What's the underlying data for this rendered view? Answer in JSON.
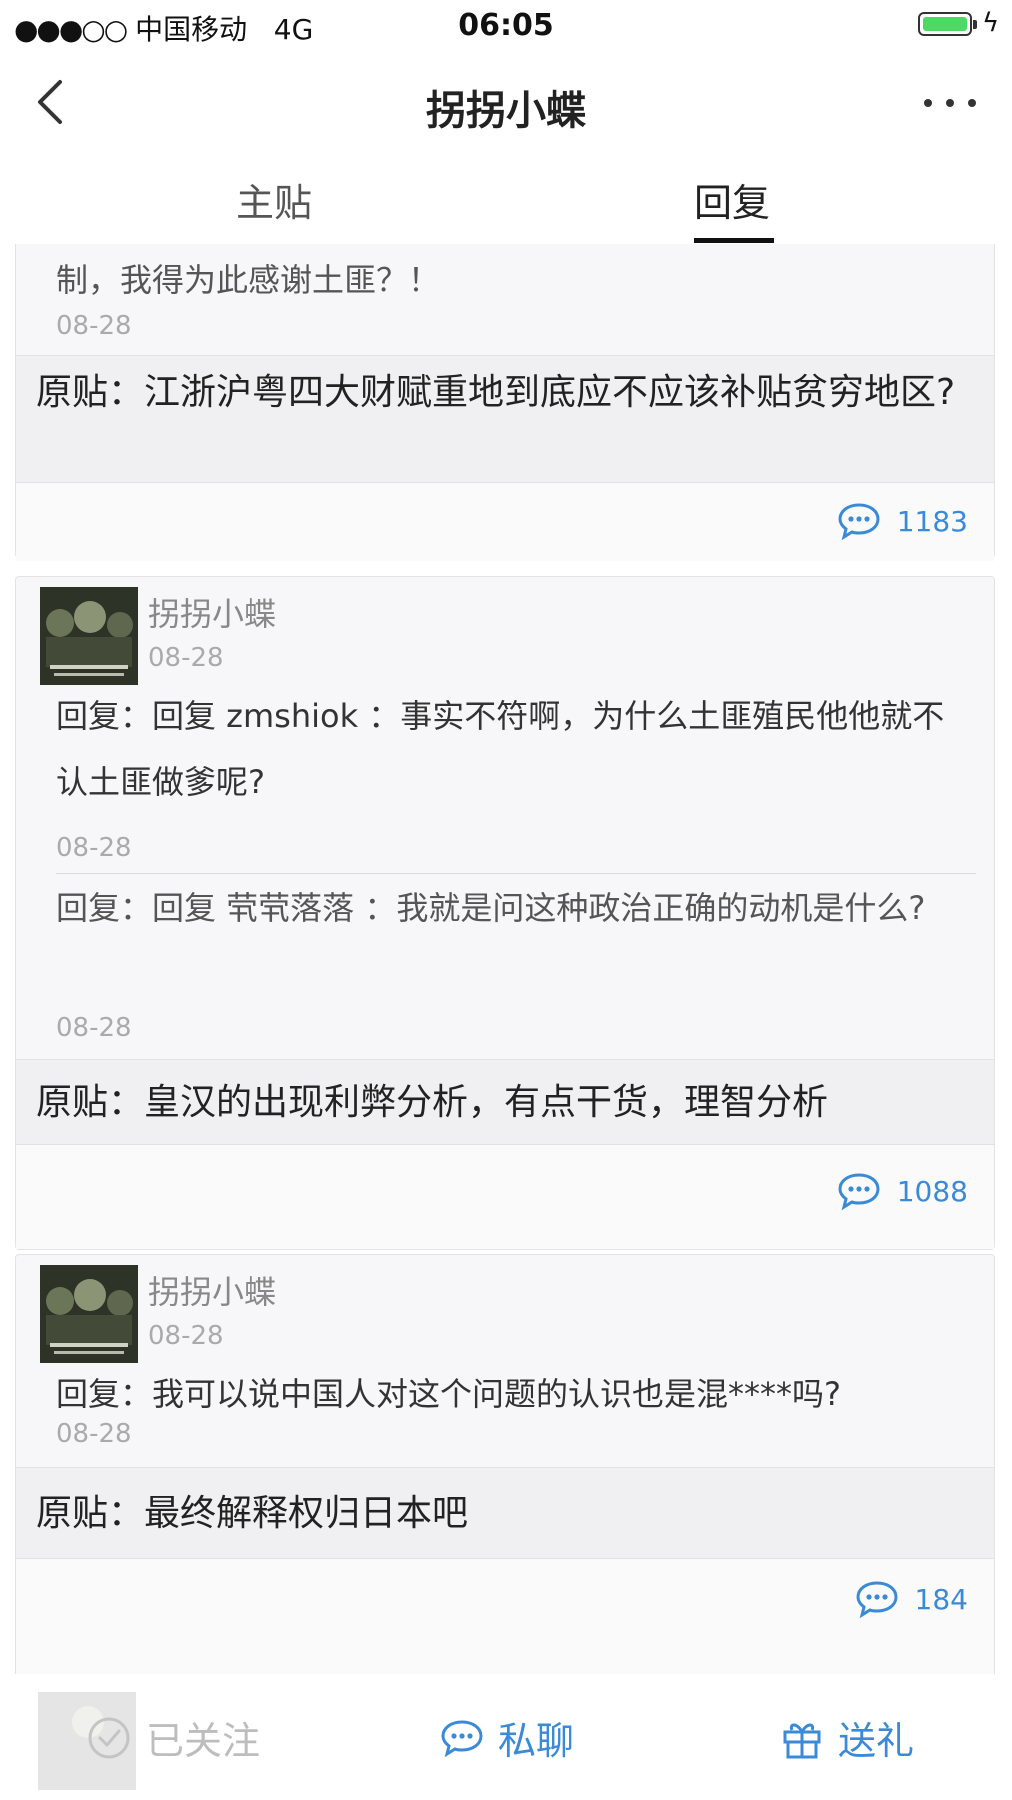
{
  "status_bar": {
    "signal": "●●●○○",
    "carrier": "中国移动",
    "network": "4G",
    "time": "06:05",
    "battery_color": "#4cd964"
  },
  "nav": {
    "back_icon": "chevron-left-icon",
    "title": "拐拐小蝶",
    "more_icon": "more-dots-icon"
  },
  "tabs": [
    {
      "label": "主贴",
      "active": false
    },
    {
      "label": "回复",
      "active": true
    }
  ],
  "feed": {
    "card0": {
      "top_text": "制，我得为此感谢土匪？！",
      "date": "08-28",
      "original": "原贴：江浙沪粤四大财赋重地到底应不应该补贴贫穷地区?",
      "comment_count": "1183"
    },
    "card1": {
      "author": "拐拐小蝶",
      "date": "08-28",
      "replies": [
        {
          "text": "回复：回复 zmshiok ：事实不符啊，为什么土匪殖民他他就不认土匪做爹呢?",
          "date": "08-28"
        },
        {
          "text": "回复：回复 茕茕落落 ：我就是问这种政治正确的动机是什么?",
          "date": "08-28"
        }
      ],
      "original": "原贴：皇汉的出现利弊分析，有点干货，理智分析",
      "comment_count": "1088"
    },
    "card2": {
      "author": "拐拐小蝶",
      "date": "08-28",
      "reply": {
        "text": "回复：我可以说中国人对这个问题的认识也是混****吗?",
        "date": "08-28"
      },
      "original": "原贴：最终解释权归日本吧",
      "comment_count": "184"
    }
  },
  "bottom_bar": {
    "follow_label": "已关注",
    "chat_label": "私聊",
    "gift_label": "送礼",
    "accent_color": "#3b8ad8"
  }
}
